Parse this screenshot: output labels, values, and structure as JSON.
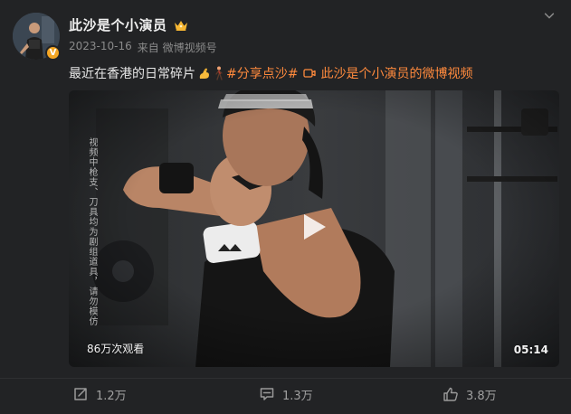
{
  "post": {
    "username": "此沙是个小演员",
    "date": "2023-10-16",
    "source": "来自 微博视频号",
    "text": "最近在香港的日常碎片",
    "hashtag": "#分享点沙#",
    "video_link_label": "此沙是个小演员的微博视频"
  },
  "video": {
    "disclaimer": "视频中枪支、刀具均为剧组道具，请勿模仿",
    "views": "86万次观看",
    "duration": "05:14"
  },
  "actions": {
    "shares": "1.2万",
    "comments": "1.3万",
    "likes": "3.8万"
  },
  "colors": {
    "background": "#222325",
    "link_accent": "#ff8a3d",
    "verified_badge": "#f5a623"
  },
  "icons": {
    "avatar_badge": "verified-v-icon",
    "name_badge": "crown-icon",
    "menu": "chevron-down-icon",
    "share": "share-icon",
    "comment": "comment-icon",
    "like": "thumbs-up-icon",
    "video": "video-camera-icon",
    "play": "play-icon"
  }
}
